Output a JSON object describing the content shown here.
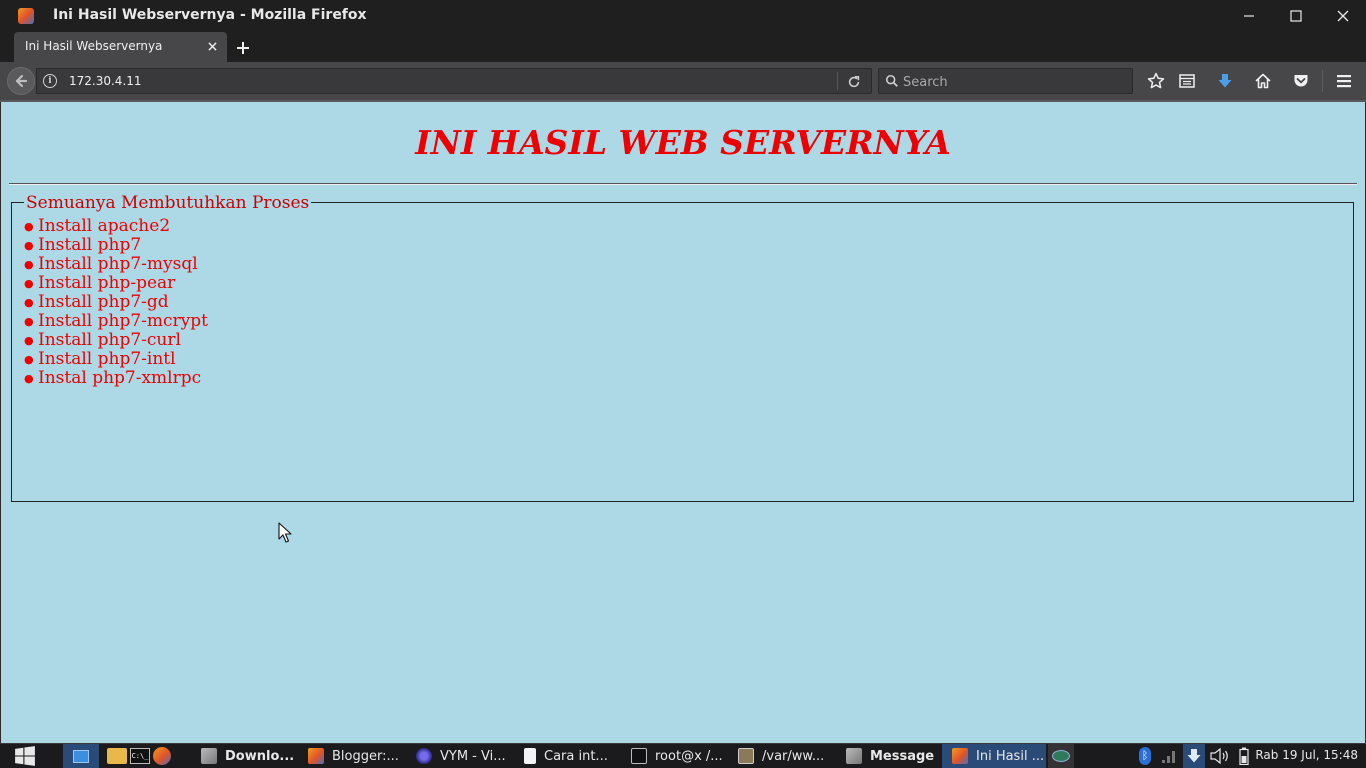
{
  "window": {
    "title": "Ini Hasil Webservernya - Mozilla Firefox"
  },
  "tabs": [
    {
      "label": "Ini Hasil Webservernya",
      "active": true
    }
  ],
  "navbar": {
    "url": "172.30.4.11",
    "search_placeholder": "Search"
  },
  "page": {
    "heading": "INI HASIL WEB SERVERNYA",
    "fieldset_legend": "Semuanya Membutuhkan Proses",
    "items": [
      "Install apache2",
      "Install php7",
      "Install php7-mysql",
      "Install php-pear",
      "Install php7-gd",
      "Install php7-mcrypt",
      "Install php7-curl",
      "Install php7-intl",
      "Instal php7-xmlrpc"
    ],
    "background_color": "#add8e6",
    "text_color": "#ee0000"
  },
  "taskbar": {
    "items": [
      {
        "label": "Downlo...",
        "bold": true,
        "active": false,
        "icon": "firefox-icon"
      },
      {
        "label": "Blogger:...",
        "bold": false,
        "active": false,
        "icon": "firefox-icon"
      },
      {
        "label": "VYM - Vi...",
        "bold": false,
        "active": false,
        "icon": "vym-icon"
      },
      {
        "label": "Cara int...",
        "bold": false,
        "active": false,
        "icon": "document-icon"
      },
      {
        "label": "root@x /...",
        "bold": false,
        "active": false,
        "icon": "terminal-icon"
      },
      {
        "label": "/var/ww...",
        "bold": false,
        "active": false,
        "icon": "editor-icon"
      },
      {
        "label": "Message",
        "bold": true,
        "active": false,
        "icon": "firefox-icon"
      },
      {
        "label": "Ini Hasil ...",
        "bold": false,
        "active": true,
        "icon": "firefox-icon"
      }
    ],
    "clock": "Rab 19 Jul, 15:48"
  }
}
